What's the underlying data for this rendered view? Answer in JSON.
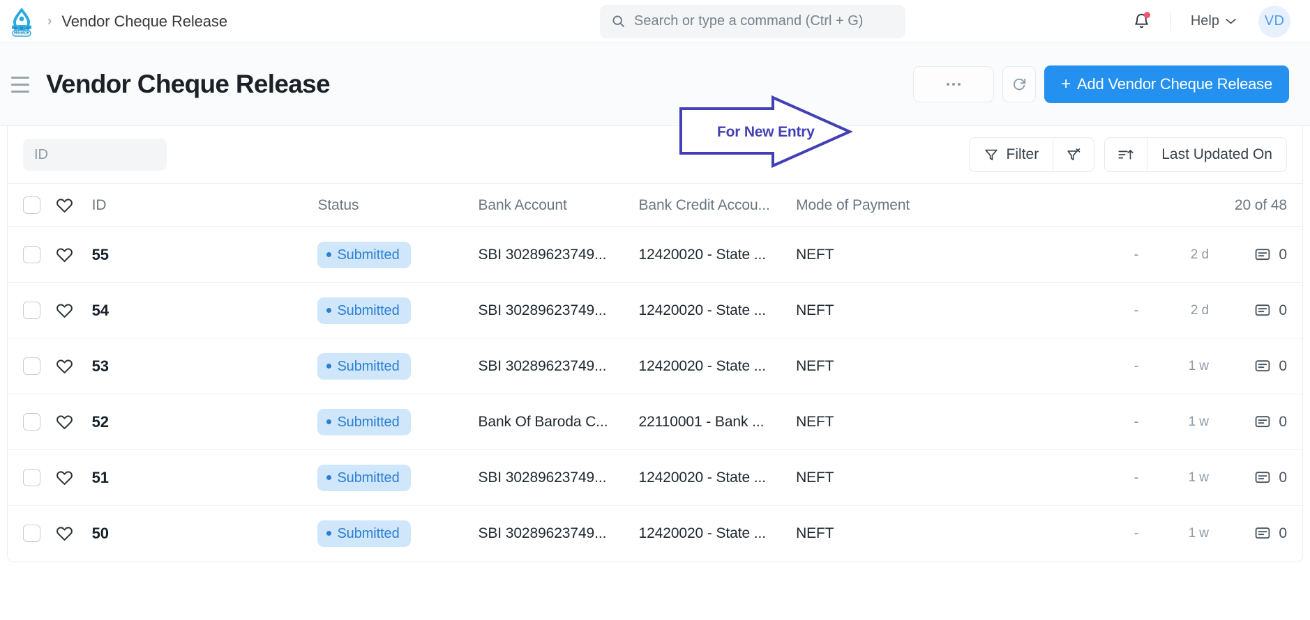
{
  "navbar": {
    "logo_alt": "Mahadk logo",
    "breadcrumb_separator": "›",
    "breadcrumb": "Vendor Cheque Release",
    "search_placeholder": "Search or type a command (Ctrl + G)",
    "search_value": "",
    "help_label": "Help",
    "avatar_initials": "VD",
    "notification_dot": true
  },
  "page": {
    "title": "Vendor Cheque Release",
    "add_button_plus": "+",
    "add_button_label": "Add Vendor Cheque Release"
  },
  "annotation": {
    "label": "For New Entry",
    "color": "#4340b5"
  },
  "toolbar": {
    "id_filter_placeholder": "ID",
    "id_filter_value": "",
    "filter_label": "Filter",
    "clear_filter_label": "",
    "sort_label": "Last Updated On"
  },
  "table": {
    "headers": {
      "id": "ID",
      "status": "Status",
      "bank_account": "Bank Account",
      "bank_credit_account": "Bank Credit Accou...",
      "mode_of_payment": "Mode of Payment",
      "count": "20 of 48"
    },
    "rows": [
      {
        "id": "55",
        "status": "Submitted",
        "bank_account": "SBI 30289623749...",
        "bank_credit_account": "12420020 - State ...",
        "mode_of_payment": "NEFT",
        "dash": "-",
        "modified": "2 d",
        "comments": "0"
      },
      {
        "id": "54",
        "status": "Submitted",
        "bank_account": "SBI 30289623749...",
        "bank_credit_account": "12420020 - State ...",
        "mode_of_payment": "NEFT",
        "dash": "-",
        "modified": "2 d",
        "comments": "0"
      },
      {
        "id": "53",
        "status": "Submitted",
        "bank_account": "SBI 30289623749...",
        "bank_credit_account": "12420020 - State ...",
        "mode_of_payment": "NEFT",
        "dash": "-",
        "modified": "1 w",
        "comments": "0"
      },
      {
        "id": "52",
        "status": "Submitted",
        "bank_account": "Bank Of Baroda C...",
        "bank_credit_account": "22110001 - Bank ...",
        "mode_of_payment": "NEFT",
        "dash": "-",
        "modified": "1 w",
        "comments": "0"
      },
      {
        "id": "51",
        "status": "Submitted",
        "bank_account": "SBI 30289623749...",
        "bank_credit_account": "12420020 - State ...",
        "mode_of_payment": "NEFT",
        "dash": "-",
        "modified": "1 w",
        "comments": "0"
      },
      {
        "id": "50",
        "status": "Submitted",
        "bank_account": "SBI 30289623749...",
        "bank_credit_account": "12420020 - State ...",
        "mode_of_payment": "NEFT",
        "dash": "-",
        "modified": "1 w",
        "comments": "0"
      }
    ]
  },
  "colors": {
    "primary": "#2490ef",
    "status_badge_bg": "#cfe6fb",
    "status_badge_text": "#2b7fd0",
    "annotation": "#4340b5",
    "notification": "#f2536d"
  }
}
